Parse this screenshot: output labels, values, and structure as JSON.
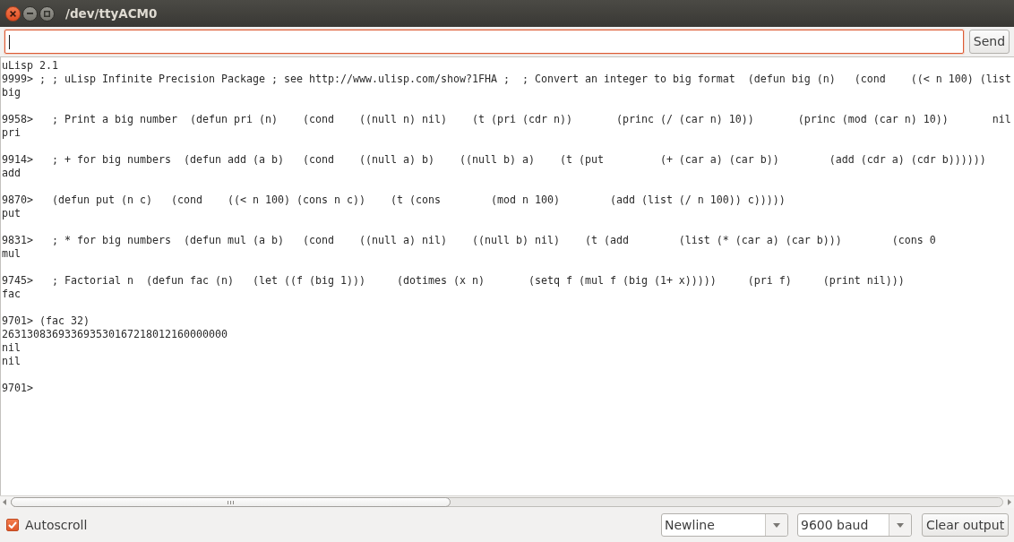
{
  "window": {
    "title": "/dev/ttyACM0"
  },
  "command_input": {
    "focused": true
  },
  "send_button": {
    "label": "Send"
  },
  "output": {
    "banner": "uLisp 2.1",
    "entries": [
      {
        "command": "9999> ; ; uLisp Infinite Precision Package ; see http://www.ulisp.com/show?1FHA ;  ; Convert an integer to big format  (defun big (n)   (cond    ((< n 100) (list",
        "result": [
          "big"
        ]
      },
      {
        "command": "9958>   ; Print a big number  (defun pri (n)    (cond    ((null n) nil)    (t (pri (cdr n))       (princ (/ (car n) 10))       (princ (mod (car n) 10))       nil",
        "result": [
          "pri"
        ]
      },
      {
        "command": "9914>   ; + for big numbers  (defun add (a b)   (cond    ((null a) b)    ((null b) a)    (t (put         (+ (car a) (car b))        (add (cdr a) (cdr b))))))",
        "result": [
          "add"
        ]
      },
      {
        "command": "9870>   (defun put (n c)   (cond    ((< n 100) (cons n c))    (t (cons        (mod n 100)        (add (list (/ n 100)) c)))))",
        "result": [
          "put"
        ]
      },
      {
        "command": "9831>   ; * for big numbers  (defun mul (a b)   (cond    ((null a) nil)    ((null b) nil)    (t (add        (list (* (car a) (car b)))        (cons 0",
        "result": [
          "mul"
        ]
      },
      {
        "command": "9745>   ; Factorial n  (defun fac (n)   (let ((f (big 1)))     (dotimes (x n)       (setq f (mul f (big (1+ x)))))     (pri f)     (print nil)))",
        "result": [
          "fac"
        ]
      },
      {
        "command": "9701> (fac 32)",
        "result": [
          "263130836933693530167218012160000000",
          "nil",
          "nil"
        ]
      }
    ],
    "prompt": "9701>"
  },
  "footer": {
    "autoscroll": {
      "label": "Autoscroll",
      "checked": true
    },
    "line_ending": {
      "value": "Newline"
    },
    "baud_rate": {
      "value": "9600 baud"
    },
    "clear_button": {
      "label": "Clear output"
    }
  }
}
